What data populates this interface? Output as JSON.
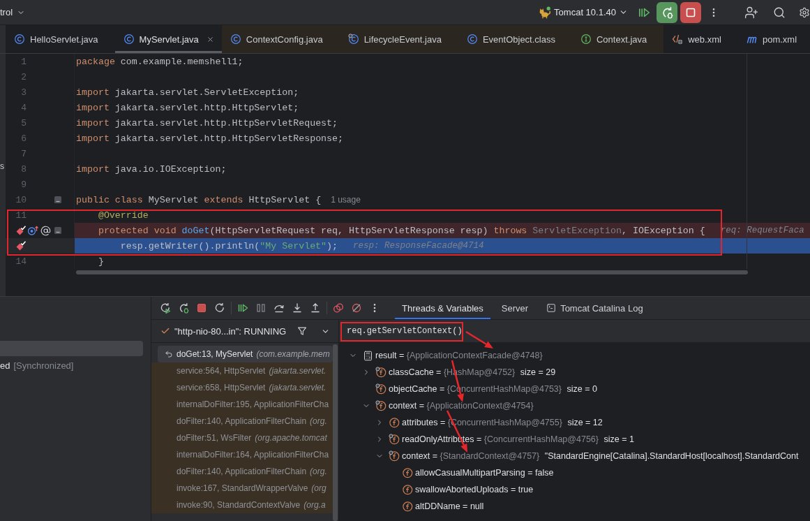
{
  "top_bar": {
    "project_widget": "trol",
    "run_configuration": "Tomcat 10.1.40"
  },
  "tabs": [
    {
      "kind": "class",
      "label": "HelloServlet.java",
      "selected": false,
      "library": false,
      "final": false
    },
    {
      "kind": "class",
      "label": "MyServlet.java",
      "selected": true,
      "library": false,
      "final": false
    },
    {
      "kind": "class",
      "label": "ContextConfig.java",
      "selected": false,
      "library": true,
      "final": false
    },
    {
      "kind": "class",
      "label": "LifecycleEvent.java",
      "selected": false,
      "library": true,
      "final": true
    },
    {
      "kind": "class",
      "label": "EventObject.class",
      "selected": false,
      "library": true,
      "final": false
    },
    {
      "kind": "interface",
      "label": "Context.java",
      "selected": false,
      "library": true,
      "final": false
    },
    {
      "kind": "xml",
      "label": "web.xml",
      "selected": false,
      "library": false,
      "final": false
    },
    {
      "kind": "maven",
      "label": "pom.xml",
      "selected": false,
      "library": false,
      "final": false
    }
  ],
  "side_panel_fragment": "s",
  "code": {
    "lines": [
      {
        "number": "1",
        "breakpoint": false,
        "execution": false,
        "tokens": [
          {
            "kind": "keyword",
            "text": "package"
          },
          {
            "kind": "plain",
            "text": " com.example.memshell1;"
          }
        ]
      },
      {
        "number": "2",
        "breakpoint": false,
        "execution": false
      },
      {
        "number": "3",
        "breakpoint": false,
        "execution": false,
        "tokens": [
          {
            "kind": "keyword",
            "text": "import"
          },
          {
            "kind": "plain",
            "text": " jakarta.servlet.ServletException;"
          }
        ]
      },
      {
        "number": "4",
        "breakpoint": false,
        "execution": false,
        "tokens": [
          {
            "kind": "keyword",
            "text": "import"
          },
          {
            "kind": "plain",
            "text": " jakarta.servlet.http.HttpServlet;"
          }
        ]
      },
      {
        "number": "5",
        "breakpoint": false,
        "execution": false,
        "tokens": [
          {
            "kind": "keyword",
            "text": "import"
          },
          {
            "kind": "plain",
            "text": " jakarta.servlet.http.HttpServletRequest;"
          }
        ]
      },
      {
        "number": "6",
        "breakpoint": false,
        "execution": false,
        "tokens": [
          {
            "kind": "keyword",
            "text": "import"
          },
          {
            "kind": "plain",
            "text": " jakarta.servlet.http.HttpServletResponse;"
          }
        ]
      },
      {
        "number": "7",
        "breakpoint": false,
        "execution": false
      },
      {
        "number": "8",
        "breakpoint": false,
        "execution": false,
        "tokens": [
          {
            "kind": "keyword",
            "text": "import"
          },
          {
            "kind": "plain",
            "text": " java.io.IOException;"
          }
        ]
      },
      {
        "number": "9",
        "breakpoint": false,
        "execution": false
      },
      {
        "number": "10",
        "breakpoint": false,
        "execution": false,
        "markers": [
          {
            "kind": "fold"
          }
        ],
        "tokens": [
          {
            "kind": "keyword",
            "text": "public class"
          },
          {
            "kind": "plain",
            "text": " MyServlet "
          },
          {
            "kind": "keyword",
            "text": "extends"
          },
          {
            "kind": "plain",
            "text": " HttpServlet {"
          }
        ],
        "hint": {
          "kind": "usage",
          "text": "1 usage"
        },
        "children": [
          {
            "number": "11",
            "breakpoint": false,
            "execution": false,
            "tokens": [
              {
                "kind": "annotation",
                "text": "@Override"
              }
            ]
          },
          {
            "breakpoint": true,
            "execution": false,
            "markers": [
              {
                "kind": "overrides"
              },
              {
                "kind": "annotation"
              },
              {
                "kind": "fold"
              }
            ],
            "tokens": [
              {
                "kind": "keyword",
                "text": "protected void"
              },
              {
                "kind": "method",
                "text": " doGet"
              },
              {
                "kind": "plain",
                "text": "(HttpServletRequest req, HttpServletResponse resp) "
              },
              {
                "kind": "keyword",
                "text": "throws"
              },
              {
                "kind": "dim",
                "text": " ServletException"
              },
              {
                "kind": "plain",
                "text": ", IOException {"
              }
            ],
            "hint": {
              "kind": "value",
              "text": "req: RequestFaca"
            },
            "children": [
              {
                "breakpoint": true,
                "execution": true,
                "tokens": [
                  {
                    "kind": "plain",
                    "text": "resp.getWriter().println("
                  },
                  {
                    "kind": "string",
                    "text": "\"My Servlet\""
                  },
                  {
                    "kind": "plain",
                    "text": ");"
                  }
                ],
                "hint": {
                  "kind": "value",
                  "text": "resp: ResponseFacade@4714"
                }
              }
            ]
          },
          {
            "number": "14",
            "breakpoint": false,
            "execution": false,
            "tokens": [
              {
                "kind": "plain",
                "text": "}"
              }
            ]
          }
        ]
      }
    ]
  },
  "debugger": {
    "left_panel": {
      "rows": [
        {
          "selected": true
        },
        {
          "label": "ed",
          "note": "[Synchronized]",
          "selected": false
        }
      ]
    },
    "tabs": [
      {
        "kind": "plain",
        "label": "Threads & Variables",
        "selected": true
      },
      {
        "kind": "plain",
        "label": "Server",
        "selected": false
      },
      {
        "kind": "console",
        "label": "Tomcat Catalina Log",
        "selected": false
      }
    ],
    "thread": "\"http-nio-80...in\": RUNNING",
    "frames": [
      {
        "method": "doGet:13, MyServlet",
        "package": "(com.example.mem",
        "selected": true,
        "library": false
      },
      {
        "method": "service:564, HttpServlet",
        "package": "(jakarta.servlet.",
        "selected": false,
        "library": true
      },
      {
        "method": "service:658, HttpServlet",
        "package": "(jakarta.servlet.",
        "selected": false,
        "library": true
      },
      {
        "method": "internalDoFilter:195, ApplicationFilterCha",
        "selected": false,
        "library": true
      },
      {
        "method": "doFilter:140, ApplicationFilterChain",
        "package": "(org.",
        "selected": false,
        "library": true
      },
      {
        "method": "doFilter:51, WsFilter",
        "package": "(org.apache.tomcat",
        "selected": false,
        "library": true
      },
      {
        "method": "internalDoFilter:164, ApplicationFilterCha",
        "selected": false,
        "library": true
      },
      {
        "method": "doFilter:140, ApplicationFilterChain",
        "package": "(org.",
        "selected": false,
        "library": true
      },
      {
        "method": "invoke:167, StandardWrapperValve",
        "package": "(org",
        "selected": false,
        "library": true
      },
      {
        "method": "invoke:90, StandardContextValve",
        "package": "(org.a",
        "selected": false,
        "library": true
      }
    ],
    "expression": "req.getServletContext()",
    "variables": [
      {
        "kind": "result",
        "name": "result",
        "op": "=",
        "ref": "{ApplicationContextFacade@4748}",
        "expanded": true,
        "children": [
          {
            "kind": "field",
            "final": true,
            "name": "classCache",
            "op": "=",
            "ref": "{HashMap@4752}",
            "value": "size = 29",
            "expanded": false
          },
          {
            "kind": "field",
            "final": true,
            "name": "objectCache",
            "op": "=",
            "ref": "{ConcurrentHashMap@4753}",
            "value": "size = 0"
          },
          {
            "kind": "field",
            "final": true,
            "name": "context",
            "op": "=",
            "ref": "{ApplicationContext@4754}",
            "expanded": true,
            "children": [
              {
                "kind": "field",
                "final": false,
                "name": "attributes",
                "op": "=",
                "ref": "{ConcurrentHashMap@4755}",
                "value": "size = 12",
                "expanded": false
              },
              {
                "kind": "field",
                "final": true,
                "name": "readOnlyAttributes",
                "op": "=",
                "ref": "{ConcurrentHashMap@4756}",
                "value": "size = 1",
                "expanded": false
              },
              {
                "kind": "field",
                "final": true,
                "name": "context",
                "op": "=",
                "ref": "{StandardContext@4757}",
                "value": "\"StandardEngine[Catalina].StandardHost[localhost].StandardCont",
                "expanded": true,
                "children": [
                  {
                    "kind": "field",
                    "final": false,
                    "name": "allowCasualMultipartParsing",
                    "op": "=",
                    "value": "false"
                  },
                  {
                    "kind": "field",
                    "final": false,
                    "name": "swallowAbortedUploads",
                    "op": "=",
                    "value": "true"
                  },
                  {
                    "kind": "field",
                    "final": false,
                    "name": "altDDName",
                    "op": "=",
                    "value": "null"
                  }
                ]
              }
            ]
          }
        ]
      }
    ]
  }
}
